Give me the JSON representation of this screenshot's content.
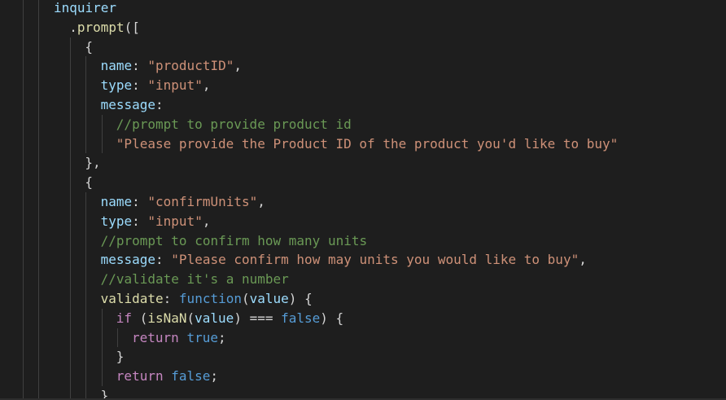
{
  "code": {
    "lines": [
      {
        "indent": 0,
        "tokens": [
          {
            "t": "inquirer",
            "c": "var"
          }
        ]
      },
      {
        "indent": 1,
        "tokens": [
          {
            "t": ".",
            "c": "pun"
          },
          {
            "t": "prompt",
            "c": "fn"
          },
          {
            "t": "([",
            "c": "pun"
          }
        ]
      },
      {
        "indent": 2,
        "tokens": [
          {
            "t": "{",
            "c": "pun"
          }
        ]
      },
      {
        "indent": 3,
        "tokens": [
          {
            "t": "name",
            "c": "var"
          },
          {
            "t": ": ",
            "c": "pun"
          },
          {
            "t": "\"productID\"",
            "c": "str"
          },
          {
            "t": ",",
            "c": "pun"
          }
        ]
      },
      {
        "indent": 3,
        "tokens": [
          {
            "t": "type",
            "c": "var"
          },
          {
            "t": ": ",
            "c": "pun"
          },
          {
            "t": "\"input\"",
            "c": "str"
          },
          {
            "t": ",",
            "c": "pun"
          }
        ]
      },
      {
        "indent": 3,
        "tokens": [
          {
            "t": "message",
            "c": "var"
          },
          {
            "t": ":",
            "c": "pun"
          }
        ]
      },
      {
        "indent": 4,
        "tokens": [
          {
            "t": "//prompt to provide product id",
            "c": "cmt"
          }
        ]
      },
      {
        "indent": 4,
        "tokens": [
          {
            "t": "\"Please provide the Product ID of the product you'd like to buy\"",
            "c": "str"
          }
        ]
      },
      {
        "indent": 2,
        "tokens": [
          {
            "t": "},",
            "c": "pun"
          }
        ]
      },
      {
        "indent": 2,
        "tokens": [
          {
            "t": "{",
            "c": "pun"
          }
        ]
      },
      {
        "indent": 3,
        "tokens": [
          {
            "t": "name",
            "c": "var"
          },
          {
            "t": ": ",
            "c": "pun"
          },
          {
            "t": "\"confirmUnits\"",
            "c": "str"
          },
          {
            "t": ",",
            "c": "pun"
          }
        ]
      },
      {
        "indent": 3,
        "tokens": [
          {
            "t": "type",
            "c": "var"
          },
          {
            "t": ": ",
            "c": "pun"
          },
          {
            "t": "\"input\"",
            "c": "str"
          },
          {
            "t": ",",
            "c": "pun"
          }
        ]
      },
      {
        "indent": 3,
        "tokens": [
          {
            "t": "//prompt to confirm how many units",
            "c": "cmt"
          }
        ]
      },
      {
        "indent": 3,
        "tokens": [
          {
            "t": "message",
            "c": "var"
          },
          {
            "t": ": ",
            "c": "pun"
          },
          {
            "t": "\"Please confirm how may units you would like to buy\"",
            "c": "str"
          },
          {
            "t": ",",
            "c": "pun"
          }
        ]
      },
      {
        "indent": 3,
        "tokens": [
          {
            "t": "//validate it's a number",
            "c": "cmt"
          }
        ]
      },
      {
        "indent": 3,
        "tokens": [
          {
            "t": "validate",
            "c": "fn"
          },
          {
            "t": ": ",
            "c": "pun"
          },
          {
            "t": "function",
            "c": "kw"
          },
          {
            "t": "(",
            "c": "pun"
          },
          {
            "t": "value",
            "c": "var"
          },
          {
            "t": ") {",
            "c": "pun"
          }
        ]
      },
      {
        "indent": 4,
        "tokens": [
          {
            "t": "if",
            "c": "kwc"
          },
          {
            "t": " (",
            "c": "pun"
          },
          {
            "t": "isNaN",
            "c": "fn"
          },
          {
            "t": "(",
            "c": "pun"
          },
          {
            "t": "value",
            "c": "var"
          },
          {
            "t": ") === ",
            "c": "pun"
          },
          {
            "t": "false",
            "c": "kw"
          },
          {
            "t": ") {",
            "c": "pun"
          }
        ]
      },
      {
        "indent": 5,
        "tokens": [
          {
            "t": "return",
            "c": "kwc"
          },
          {
            "t": " ",
            "c": "pun"
          },
          {
            "t": "true",
            "c": "kw"
          },
          {
            "t": ";",
            "c": "pun"
          }
        ]
      },
      {
        "indent": 4,
        "tokens": [
          {
            "t": "}",
            "c": "pun"
          }
        ]
      },
      {
        "indent": 4,
        "tokens": [
          {
            "t": "return",
            "c": "kwc"
          },
          {
            "t": " ",
            "c": "pun"
          },
          {
            "t": "false",
            "c": "kw"
          },
          {
            "t": ";",
            "c": "pun"
          }
        ]
      },
      {
        "indent": 3,
        "tokens": [
          {
            "t": "}",
            "c": "pun"
          }
        ]
      }
    ]
  },
  "colors": {
    "background": "#1e1e1e",
    "variable": "#9cdcfe",
    "string": "#ce9178",
    "comment": "#6a9955",
    "keyword": "#569cd6",
    "function": "#dcdcaa",
    "control": "#c586c0",
    "punctuation": "#d4d4d4"
  }
}
